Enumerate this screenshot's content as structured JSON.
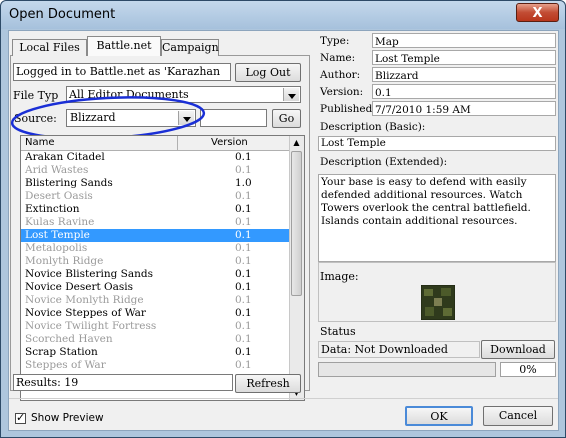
{
  "window": {
    "title": "Open Document",
    "close_glyph": "X"
  },
  "tabs": [
    {
      "label": "Local Files"
    },
    {
      "label": "Battle.net",
      "active": true
    },
    {
      "label": "Campaign"
    }
  ],
  "login": {
    "status": "Logged in to Battle.net as 'Karazhan",
    "logout_label": "Log Out"
  },
  "file_type": {
    "label": "File Typ",
    "value": "All Editor Documents"
  },
  "source": {
    "label": "Source:",
    "value": "Blizzard",
    "search_value": "",
    "go_label": "Go"
  },
  "list": {
    "columns": {
      "name": "Name",
      "version": "Version"
    },
    "rows": [
      {
        "name": "Arakan Citadel",
        "version": "0.1",
        "dim": false
      },
      {
        "name": "Arid Wastes",
        "version": "0.1",
        "dim": true
      },
      {
        "name": "Blistering Sands",
        "version": "1.0",
        "dim": false
      },
      {
        "name": "Desert Oasis",
        "version": "0.1",
        "dim": true
      },
      {
        "name": "Extinction",
        "version": "0.1",
        "dim": false
      },
      {
        "name": "Kulas Ravine",
        "version": "0.1",
        "dim": true
      },
      {
        "name": "Lost Temple",
        "version": "0.1",
        "dim": false,
        "selected": true
      },
      {
        "name": "Metalopolis",
        "version": "0.1",
        "dim": true
      },
      {
        "name": "Monlyth Ridge",
        "version": "0.1",
        "dim": true
      },
      {
        "name": "Novice Blistering Sands",
        "version": "0.1",
        "dim": false
      },
      {
        "name": "Novice Desert Oasis",
        "version": "0.1",
        "dim": false
      },
      {
        "name": "Novice Monlyth Ridge",
        "version": "0.1",
        "dim": true
      },
      {
        "name": "Novice Steppes of War",
        "version": "0.1",
        "dim": false
      },
      {
        "name": "Novice Twilight Fortress",
        "version": "0.1",
        "dim": true
      },
      {
        "name": "Scorched Haven",
        "version": "0.1",
        "dim": true
      },
      {
        "name": "Scrap Station",
        "version": "0.1",
        "dim": false
      },
      {
        "name": "Steppes of War",
        "version": "0.1",
        "dim": true
      }
    ]
  },
  "results": {
    "text": "Results: 19",
    "refresh_label": "Refresh"
  },
  "details": {
    "type_label": "Type:",
    "type_value": "Map",
    "name_label": "Name:",
    "name_value": "Lost Temple",
    "author_label": "Author:",
    "author_value": "Blizzard",
    "version_label": "Version:",
    "version_value": "0.1",
    "published_label": "Published",
    "published_value": "7/7/2010 1:59 AM",
    "desc_basic_label": "Description (Basic):",
    "desc_basic_value": "Lost Temple",
    "desc_ext_label": "Description (Extended):",
    "desc_ext_value": "Your base is easy to defend with easily defended additional resources. Watch Towers overlook the central battlefield. Islands contain additional resources.",
    "image_label": "Image:",
    "status_label": "Status",
    "data_status": "Data: Not Downloaded",
    "download_label": "Download",
    "progress_percent": 0,
    "progress_text": "0%"
  },
  "footer": {
    "show_preview_label": "Show Preview",
    "show_preview_checked": true,
    "ok_label": "OK",
    "cancel_label": "Cancel"
  },
  "colors": {
    "selection": "#3399ff",
    "annotation_circle": "#1a2fd6",
    "title_bar": "#aec6dd"
  },
  "icons": {
    "close": "close-icon",
    "dropdown": "chevron-down-icon",
    "preview": "map-thumbnail-image"
  }
}
